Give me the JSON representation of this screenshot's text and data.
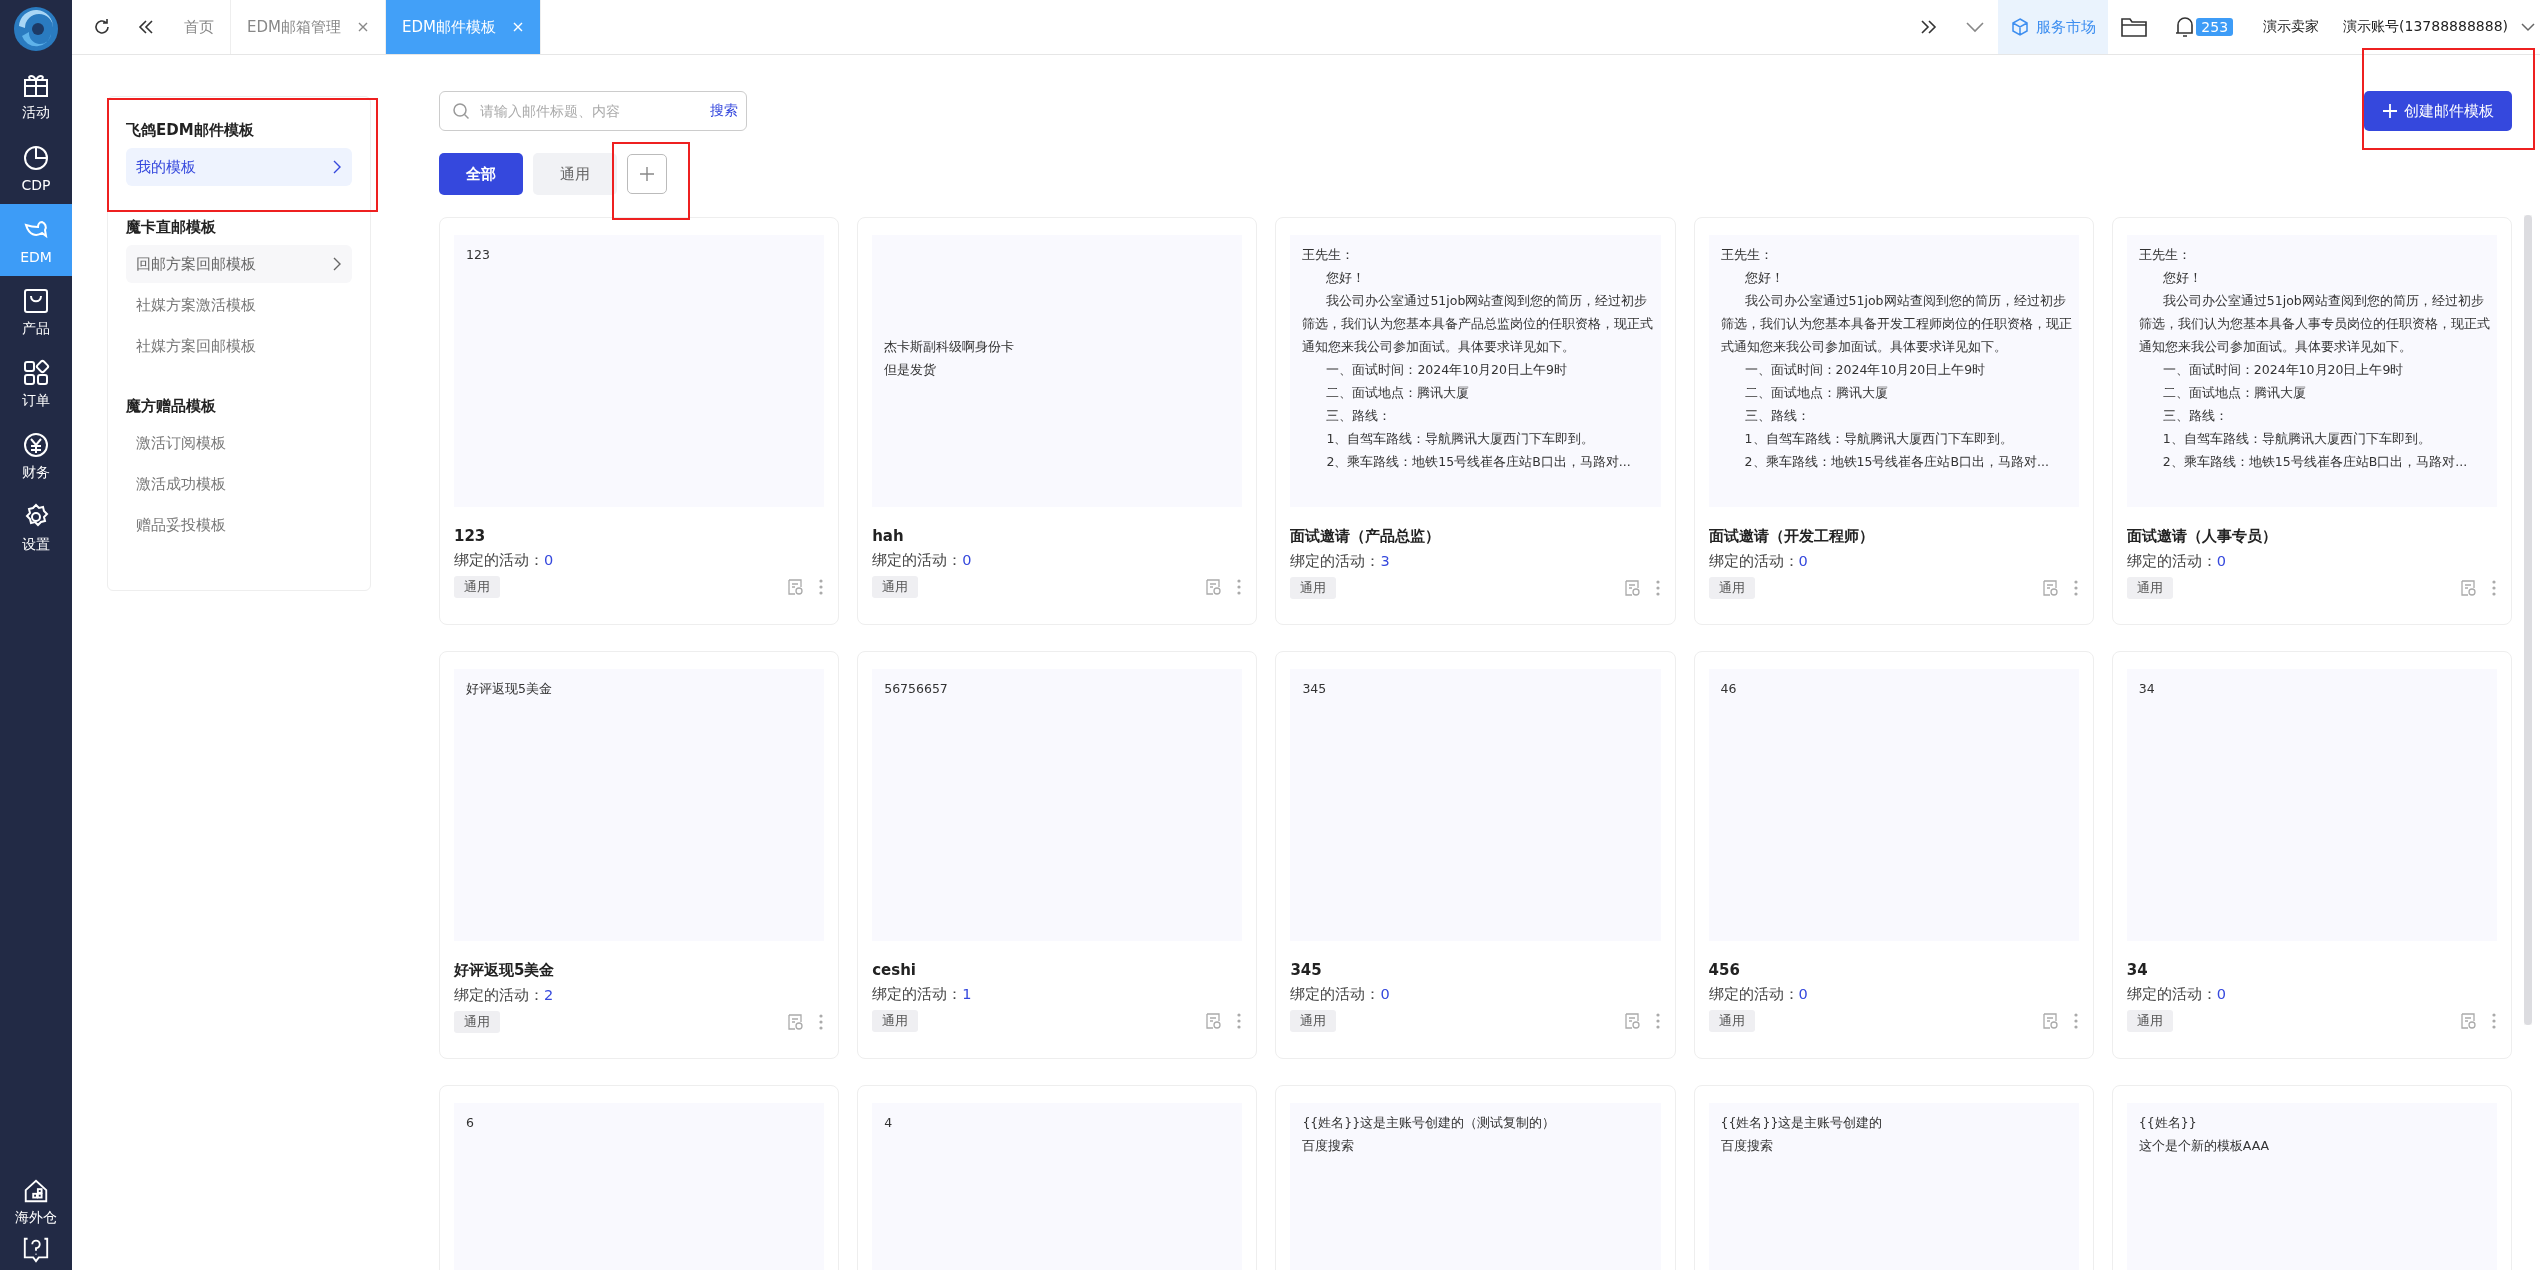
{
  "nav": {
    "items": [
      {
        "label": "活动",
        "selected": false
      },
      {
        "label": "CDP",
        "selected": false
      },
      {
        "label": "EDM",
        "selected": true
      },
      {
        "label": "产品",
        "selected": false
      },
      {
        "label": "订单",
        "selected": false
      },
      {
        "label": "财务",
        "selected": false
      },
      {
        "label": "设置",
        "selected": false
      }
    ],
    "bottom_item": {
      "label": "海外仓"
    }
  },
  "tabs": [
    {
      "label": "首页",
      "closable": false,
      "selected": false
    },
    {
      "label": "EDM邮箱管理",
      "closable": true,
      "selected": false
    },
    {
      "label": "EDM邮件模板",
      "closable": true,
      "selected": true
    }
  ],
  "header": {
    "market": "服务市场",
    "notifications": "253",
    "shop": "演示卖家",
    "account": "演示账号(13788888888)"
  },
  "template_groups": [
    {
      "title": "飞鸽EDM邮件模板",
      "items": [
        {
          "label": "我的模板",
          "selected": true,
          "expandable": true
        }
      ]
    },
    {
      "title": "魔卡直邮模板",
      "items": [
        {
          "label": "回邮方案回邮模板",
          "selected": false,
          "expandable": true
        },
        {
          "label": "社媒方案激活模板",
          "selected": false,
          "expandable": false
        },
        {
          "label": "社媒方案回邮模板",
          "selected": false,
          "expandable": false
        }
      ]
    },
    {
      "title": "魔方赠品模板",
      "items": [
        {
          "label": "激活订阅模板",
          "selected": false,
          "expandable": false
        },
        {
          "label": "激活成功模板",
          "selected": false,
          "expandable": false
        },
        {
          "label": "赠品妥投模板",
          "selected": false,
          "expandable": false
        }
      ]
    }
  ],
  "search": {
    "placeholder": "请输入邮件标题、内容",
    "button": "搜索"
  },
  "filters": [
    {
      "label": "全部",
      "selected": true
    },
    {
      "label": "通用",
      "selected": false
    }
  ],
  "create_button": "创建邮件模板",
  "cards": [
    {
      "preview": [
        {
          "text": "123"
        }
      ],
      "title": "123",
      "bound_label": "绑定的活动：",
      "bound_count": "0",
      "tag": "通用"
    },
    {
      "preview": [
        {
          "text": "\n\n\n\n杰卡斯副科级啊身份卡"
        },
        {
          "text": "但是发货"
        }
      ],
      "title": "hah",
      "bound_label": "绑定的活动：",
      "bound_count": "0",
      "tag": "通用"
    },
    {
      "preview": [
        {
          "text": "王先生：",
          "indent": false
        },
        {
          "text": "您好！",
          "indent": true
        },
        {
          "text": "我公司办公室通过51job网站查阅到您的简历，经过初步筛选，我们认为您基本具备产品总监岗位的任职资格，现正式通知您来我公司参加面试。具体要求详见如下。",
          "indent": true
        },
        {
          "text": "一、面试时间：2024年10月20日上午9时",
          "indent": true
        },
        {
          "text": "二、面试地点：腾讯大厦",
          "indent": true
        },
        {
          "text": "三、路线：",
          "indent": true
        },
        {
          "text": "1、自驾车路线：导航腾讯大厦西门下车即到。",
          "indent": true
        },
        {
          "text": "2、乘车路线：地铁15号线崔各庄站B口出，马路对...",
          "indent": true
        }
      ],
      "title": "面试邀请（产品总监）",
      "bound_label": "绑定的活动：",
      "bound_count": "3",
      "tag": "通用"
    },
    {
      "preview": [
        {
          "text": "王先生：",
          "indent": false
        },
        {
          "text": "您好！",
          "indent": true
        },
        {
          "text": "我公司办公室通过51job网站查阅到您的简历，经过初步筛选，我们认为您基本具备开发工程师岗位的任职资格，现正式通知您来我公司参加面试。具体要求详见如下。",
          "indent": true
        },
        {
          "text": "一、面试时间：2024年10月20日上午9时",
          "indent": true
        },
        {
          "text": "二、面试地点：腾讯大厦",
          "indent": true
        },
        {
          "text": "三、路线：",
          "indent": true
        },
        {
          "text": "1、自驾车路线：导航腾讯大厦西门下车即到。",
          "indent": true
        },
        {
          "text": "2、乘车路线：地铁15号线崔各庄站B口出，马路对...",
          "indent": true
        }
      ],
      "title": "面试邀请（开发工程师）",
      "bound_label": "绑定的活动：",
      "bound_count": "0",
      "tag": "通用"
    },
    {
      "preview": [
        {
          "text": "王先生：",
          "indent": false
        },
        {
          "text": "您好！",
          "indent": true
        },
        {
          "text": "我公司办公室通过51job网站查阅到您的简历，经过初步筛选，我们认为您基本具备人事专员岗位的任职资格，现正式通知您来我公司参加面试。具体要求详见如下。",
          "indent": true
        },
        {
          "text": "一、面试时间：2024年10月20日上午9时",
          "indent": true
        },
        {
          "text": "二、面试地点：腾讯大厦",
          "indent": true
        },
        {
          "text": "三、路线：",
          "indent": true
        },
        {
          "text": "1、自驾车路线：导航腾讯大厦西门下车即到。",
          "indent": true
        },
        {
          "text": "2、乘车路线：地铁15号线崔各庄站B口出，马路对...",
          "indent": true
        }
      ],
      "title": "面试邀请（人事专员）",
      "bound_label": "绑定的活动：",
      "bound_count": "0",
      "tag": "通用"
    },
    {
      "preview": [
        {
          "text": "好评返现5美金"
        }
      ],
      "title": "好评返现5美金",
      "bound_label": "绑定的活动：",
      "bound_count": "2",
      "tag": "通用"
    },
    {
      "preview": [
        {
          "text": "56756657"
        }
      ],
      "title": "ceshi",
      "bound_label": "绑定的活动：",
      "bound_count": "1",
      "tag": "通用"
    },
    {
      "preview": [
        {
          "text": "345"
        }
      ],
      "title": "345",
      "bound_label": "绑定的活动：",
      "bound_count": "0",
      "tag": "通用"
    },
    {
      "preview": [
        {
          "text": "46"
        }
      ],
      "title": "456",
      "bound_label": "绑定的活动：",
      "bound_count": "0",
      "tag": "通用"
    },
    {
      "preview": [
        {
          "text": "34"
        }
      ],
      "title": "34",
      "bound_label": "绑定的活动：",
      "bound_count": "0",
      "tag": "通用"
    },
    {
      "preview": [
        {
          "text": "6"
        }
      ]
    },
    {
      "preview": [
        {
          "text": "4"
        }
      ]
    },
    {
      "preview": [
        {
          "text": "{{姓名}}这是主账号创建的（测试复制的）"
        },
        {
          "text": "百度搜索"
        }
      ]
    },
    {
      "preview": [
        {
          "text": "{{姓名}}这是主账号创建的"
        },
        {
          "text": "百度搜索"
        }
      ]
    },
    {
      "preview": [
        {
          "text": "{{姓名}}"
        },
        {
          "text": "这个是个新的模板AAA"
        }
      ]
    }
  ]
}
